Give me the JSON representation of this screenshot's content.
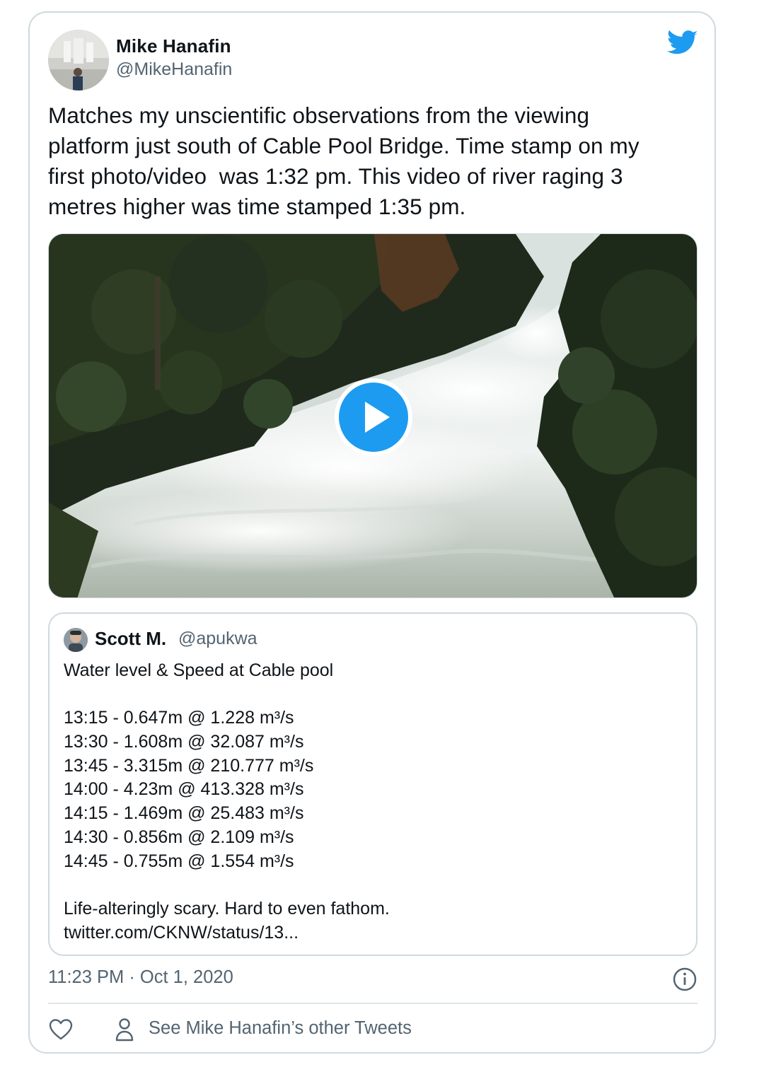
{
  "tweet": {
    "author_name": "Mike Hanafin",
    "author_handle": "@MikeHanafin",
    "text_lines": [
      "Matches my unscientific observations from the viewing",
      "platform just south of Cable Pool Bridge. Time stamp on my",
      "first photo/video  was 1:32 pm. This video of river raging 3",
      "metres higher was time stamped 1:35 pm."
    ],
    "timestamp": "11:23 PM · Oct 1, 2020",
    "other_tweets_label": "See Mike Hanafin’s other Tweets"
  },
  "quoted_tweet": {
    "author_name": "Scott M.",
    "author_handle": "@apukwa",
    "title_line": "Water level & Speed at Cable pool",
    "readings": [
      "13:15 - 0.647m @ 1.228 m³/s",
      "13:30 - 1.608m @ 32.087 m³/s",
      "13:45 - 3.315m @ 210.777 m³/s",
      "14:00 - 4.23m @ 413.328 m³/s",
      "14:15 - 1.469m @ 25.483 m³/s",
      "14:30 - 0.856m @ 2.109 m³/s",
      "14:45 - 0.755m @ 1.554 m³/s"
    ],
    "closing_line": "Life-alteringly scary. Hard to even fathom.",
    "link_text": "twitter.com/CKNW/status/13..."
  },
  "icons": {
    "brand": "twitter-bird-icon",
    "play": "play-icon",
    "info": "info-icon",
    "like": "heart-icon",
    "profile": "person-icon"
  },
  "colors": {
    "twitter_blue": "#1d9bf0",
    "text": "#0f1419",
    "secondary_text": "#536471",
    "border": "#cfd9de"
  }
}
